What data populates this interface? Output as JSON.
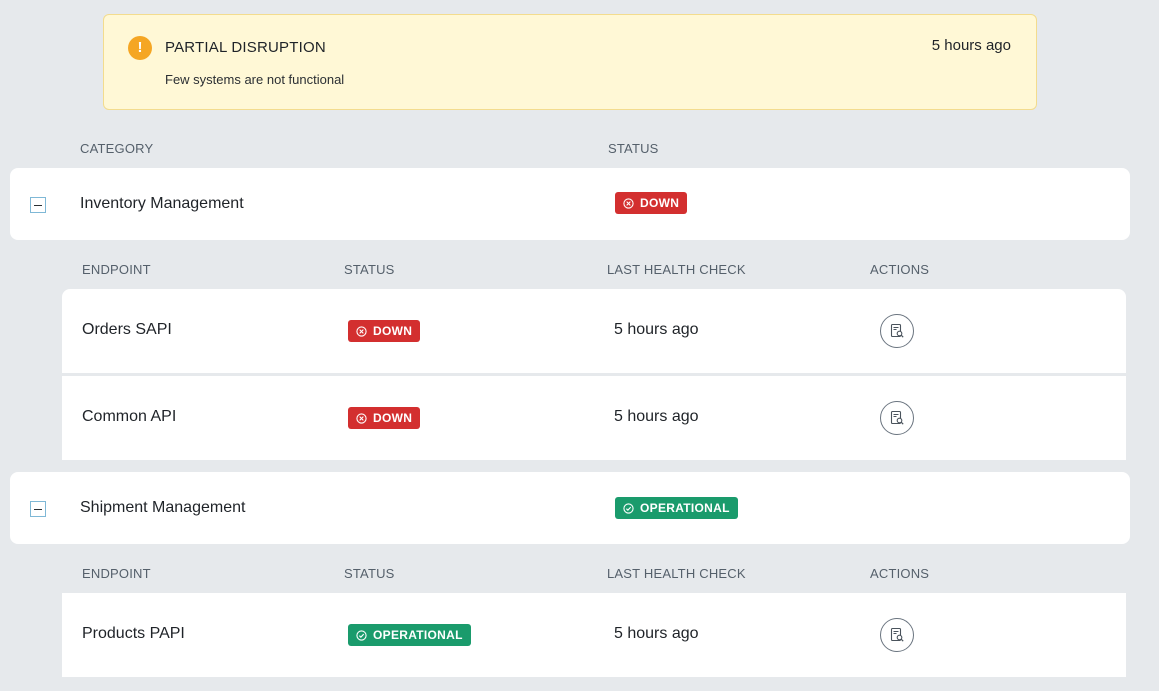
{
  "alert": {
    "icon": "exclamation-icon",
    "title": "PARTIAL DISRUPTION",
    "message": "Few systems are not functional",
    "time": "5 hours ago",
    "color": "#f5a623"
  },
  "category_headers": {
    "category": "CATEGORY",
    "status": "STATUS"
  },
  "endpoint_headers": {
    "endpoint": "ENDPOINT",
    "status": "STATUS",
    "last_check": "LAST HEALTH CHECK",
    "actions": "ACTIONS"
  },
  "status_colors": {
    "down": "#d32f2f",
    "operational": "#1a9b6c"
  },
  "categories": [
    {
      "name": "Inventory Management",
      "status": "DOWN",
      "endpoints": [
        {
          "name": "Orders SAPI",
          "status": "DOWN",
          "last_check": "5 hours ago",
          "action_icon": "report-search-icon"
        },
        {
          "name": "Common API",
          "status": "DOWN",
          "last_check": "5 hours ago",
          "action_icon": "report-search-icon"
        }
      ]
    },
    {
      "name": "Shipment Management",
      "status": "OPERATIONAL",
      "endpoints": [
        {
          "name": "Products PAPI",
          "status": "OPERATIONAL",
          "last_check": "5 hours ago",
          "action_icon": "report-search-icon"
        }
      ]
    }
  ]
}
